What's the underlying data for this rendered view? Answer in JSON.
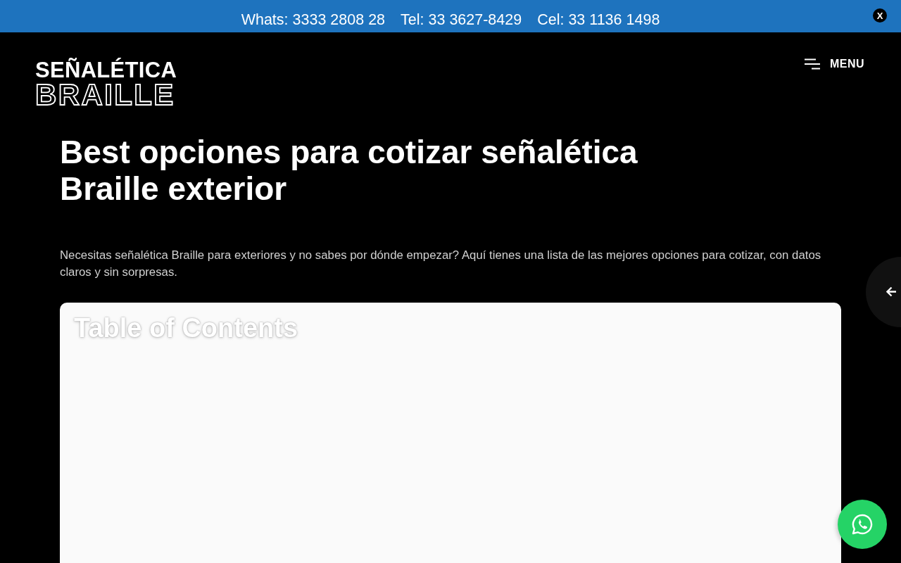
{
  "top_bar": {
    "contacts": [
      "Whats: 3333 2808 28",
      "Tel: 33 3627-8429",
      "Cel: 33 1136 1498"
    ],
    "close_label": "X"
  },
  "header": {
    "logo": {
      "line_1": "SEÑALÉTICA",
      "line_2": "BRAILLE"
    },
    "menu_label": "MENU"
  },
  "article": {
    "title": "Best opciones para cotizar señalética Braille exterior",
    "intro": "Necesitas señalética Braille para exteriores y no sabes por dónde empezar? Aquí tienes una lista de las mejores opciones para cotizar, con datos claros y sin sorpresas."
  },
  "table_of_contents": {
    "heading": "Table of Contents"
  }
}
